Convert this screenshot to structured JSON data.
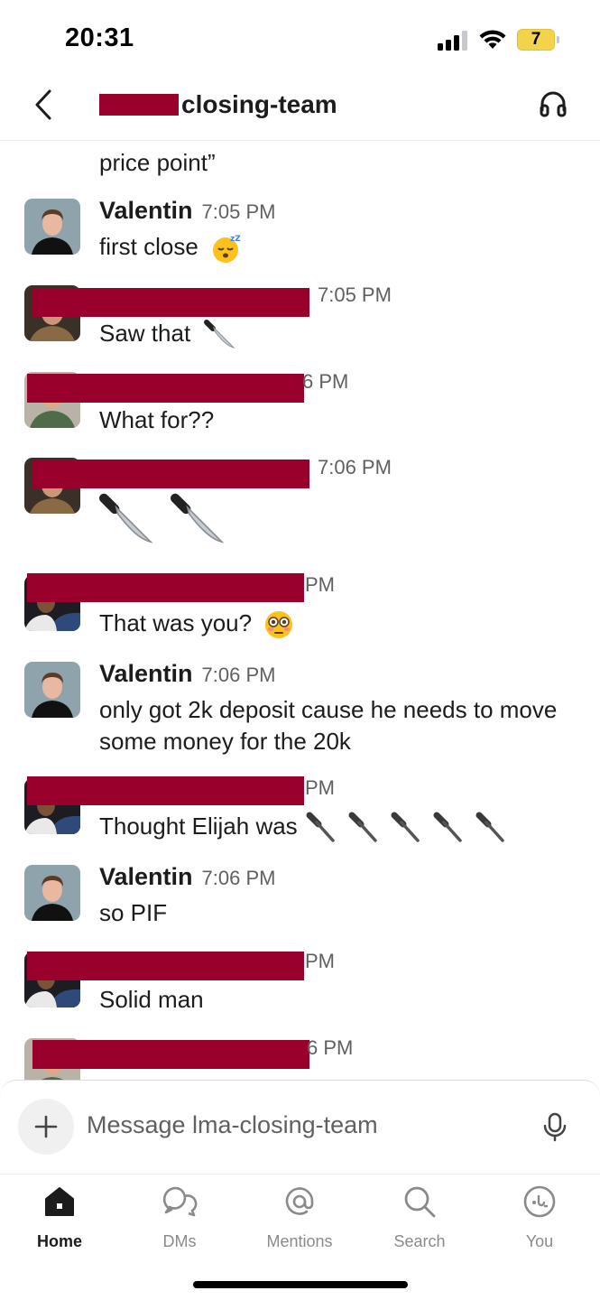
{
  "status_bar": {
    "time": "20:31",
    "battery": "7"
  },
  "header": {
    "channel_name": "closing-team"
  },
  "messages": {
    "partial_previous": "price point”",
    "items": [
      {
        "name": "Valentin",
        "time": "7:05 PM",
        "text": "first close",
        "emoji": "sleeping-face"
      },
      {
        "name": "",
        "time": "7:05 PM",
        "text": "Saw that",
        "emoji": "knife"
      },
      {
        "name": "",
        "time": "6 PM",
        "text": "What for??",
        "emoji": ""
      },
      {
        "name": "",
        "time": "7:06 PM",
        "text": "",
        "emoji": "knife knife"
      },
      {
        "name": "",
        "time": "PM",
        "text": "That was you?",
        "emoji": "flushed-face"
      },
      {
        "name": "Valentin",
        "time": "7:06 PM",
        "text": "only got 2k deposit cause he needs to move some money for the 20k",
        "emoji": ""
      },
      {
        "name": "",
        "time": "PM",
        "text": "Thought Elijah was",
        "emoji": "hammer x5"
      },
      {
        "name": "Valentin",
        "time": "7:06 PM",
        "text": "so PIF",
        "emoji": ""
      },
      {
        "name": "",
        "time": "PM",
        "text": "Solid man",
        "emoji": ""
      },
      {
        "name": "",
        "time": "6 PM",
        "text": "",
        "emoji": ""
      }
    ]
  },
  "composer": {
    "placeholder": "Message lma-closing-team"
  },
  "tabs": [
    {
      "label": "Home",
      "icon": "home-icon",
      "active": true
    },
    {
      "label": "DMs",
      "icon": "dms-icon",
      "active": false
    },
    {
      "label": "Mentions",
      "icon": "mentions-icon",
      "active": false
    },
    {
      "label": "Search",
      "icon": "search-icon",
      "active": false
    },
    {
      "label": "You",
      "icon": "you-icon",
      "active": false
    }
  ],
  "colors": {
    "redaction": "#99002b",
    "text": "#1d1c1d",
    "muted": "#616061",
    "battery": "#f2d34b"
  }
}
